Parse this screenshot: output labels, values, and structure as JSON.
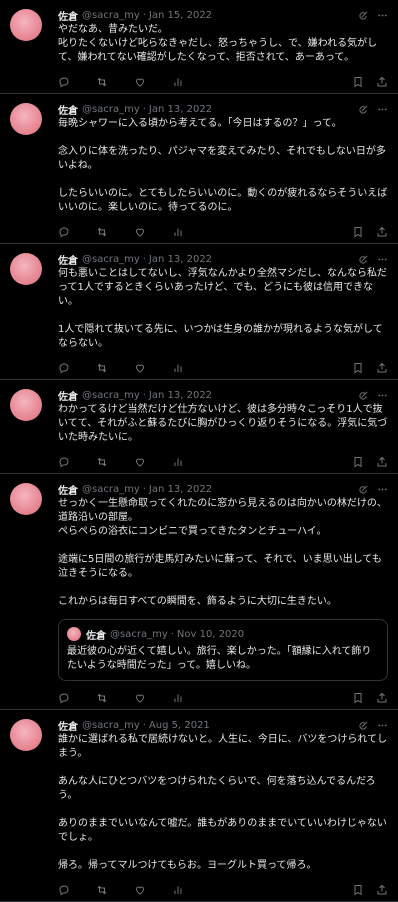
{
  "tweets": [
    {
      "name": "佐倉",
      "handle": "@sacra_my",
      "date": "Jan 15, 2022",
      "paragraphs": [
        "やだなあ、昔みたいだ。",
        "叱りたくないけど叱らなきゃだし、怒っちゃうし、で、嫌われる気がして、嫌われてない確認がしたくなって、拒否されて、あーあって。"
      ]
    },
    {
      "name": "佐倉",
      "handle": "@sacra_my",
      "date": "Jan 13, 2022",
      "paragraphs": [
        "毎晩シャワーに入る頃から考えてる。「今日はするの？」って。",
        "",
        "念入りに体を洗ったり、パジャマを変えてみたり、それでもしない日が多いよね。",
        "",
        "したらいいのに。とてもしたらいいのに。動くのが疲れるならそういえばいいのに。楽しいのに。待ってるのに。"
      ]
    },
    {
      "name": "佐倉",
      "handle": "@sacra_my",
      "date": "Jan 13, 2022",
      "paragraphs": [
        "何も悪いことはしてないし、浮気なんかより全然マシだし、なんなら私だって1人でするときくらいあったけど、でも、どうにも彼は信用できない。",
        "",
        "1人で隠れて抜いてる先に、いつかは生身の誰かが現れるような気がしてならない。"
      ]
    },
    {
      "name": "佐倉",
      "handle": "@sacra_my",
      "date": "Jan 13, 2022",
      "paragraphs": [
        "わかってるけど当然だけど仕方ないけど、彼は多分時々こっそり1人で抜いてて、それがふと蘇るたびに胸がひっくり返りそうになる。浮気に気づいた時みたいに。"
      ]
    },
    {
      "name": "佐倉",
      "handle": "@sacra_my",
      "date": "Jan 13, 2022",
      "paragraphs": [
        "せっかく一生懸命取ってくれたのに窓から見えるのは向かいの林だけの、道路沿いの部屋。",
        "ぺらぺらの浴衣にコンビニで買ってきたタンとチューハイ。",
        "",
        "途端に5日間の旅行が走馬灯みたいに蘇って、それで、いま思い出しても泣きそうになる。",
        "",
        "これからは毎日すべての瞬間を、飾るように大切に生きたい。"
      ],
      "quote": {
        "name": "佐倉",
        "handle": "@sacra_my",
        "date": "Nov 10, 2020",
        "paragraphs": [
          "最近彼の心が近くて嬉しい。旅行、楽しかった。「額縁に入れて飾りたいような時間だった」って。嬉しいね。"
        ]
      }
    },
    {
      "name": "佐倉",
      "handle": "@sacra_my",
      "date": "Aug 5, 2021",
      "paragraphs": [
        "誰かに選ばれる私で居続けないと。人生に、今日に、バツをつけられてしまう。",
        "",
        "あんな人にひとつバツをつけられたくらいで、何を落ち込んでるんだろう。",
        "",
        "ありのままでいいなんて嘘だ。誰もがありのままでいていいわけじゃないでしょ。",
        "",
        "帰ろ。帰ってマルつけてもらお。ヨーグルト買って帰ろ。"
      ]
    }
  ],
  "colors": {
    "background": "#000000",
    "text": "#e7e9ea",
    "muted": "#71767b",
    "divider": "#2f3336"
  },
  "icons": [
    "grok-icon",
    "more-icon",
    "reply-icon",
    "retweet-icon",
    "like-icon",
    "views-icon",
    "bookmark-icon",
    "share-icon"
  ]
}
